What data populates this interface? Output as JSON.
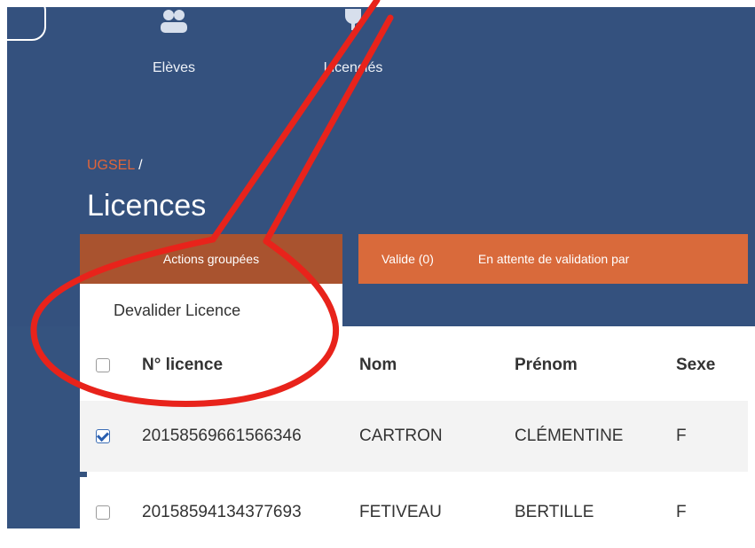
{
  "nav": {
    "items": [
      {
        "label": "Elèves",
        "icon": "users-icon"
      },
      {
        "label": "Licenciés",
        "icon": "trophy-icon"
      }
    ]
  },
  "breadcrumb": {
    "link": "UGSEL",
    "separator": " /"
  },
  "page": {
    "title": "Licences"
  },
  "toolbar": {
    "actions_label": "Actions groupées",
    "filter_valide": "Valide (0)",
    "filter_attente": "En attente de validation par"
  },
  "dropdown": {
    "items": [
      "Devalider Licence"
    ]
  },
  "table": {
    "columns": [
      "N° licence",
      "Nom",
      "Prénom",
      "Sexe"
    ],
    "rows": [
      {
        "checked": true,
        "licence": "2015856966156634‍6",
        "nom": "CARTRON",
        "prenom": "CLÉMENTINE",
        "sexe": "F"
      },
      {
        "checked": false,
        "licence": "20158594134377693",
        "nom": "FETIVEAU",
        "prenom": "BERTILLE",
        "sexe": "F"
      }
    ]
  },
  "colors": {
    "header_bg": "#34517e",
    "accent_dark": "#a9532f",
    "accent": "#d96a3b",
    "annotation": "#e8231b"
  }
}
